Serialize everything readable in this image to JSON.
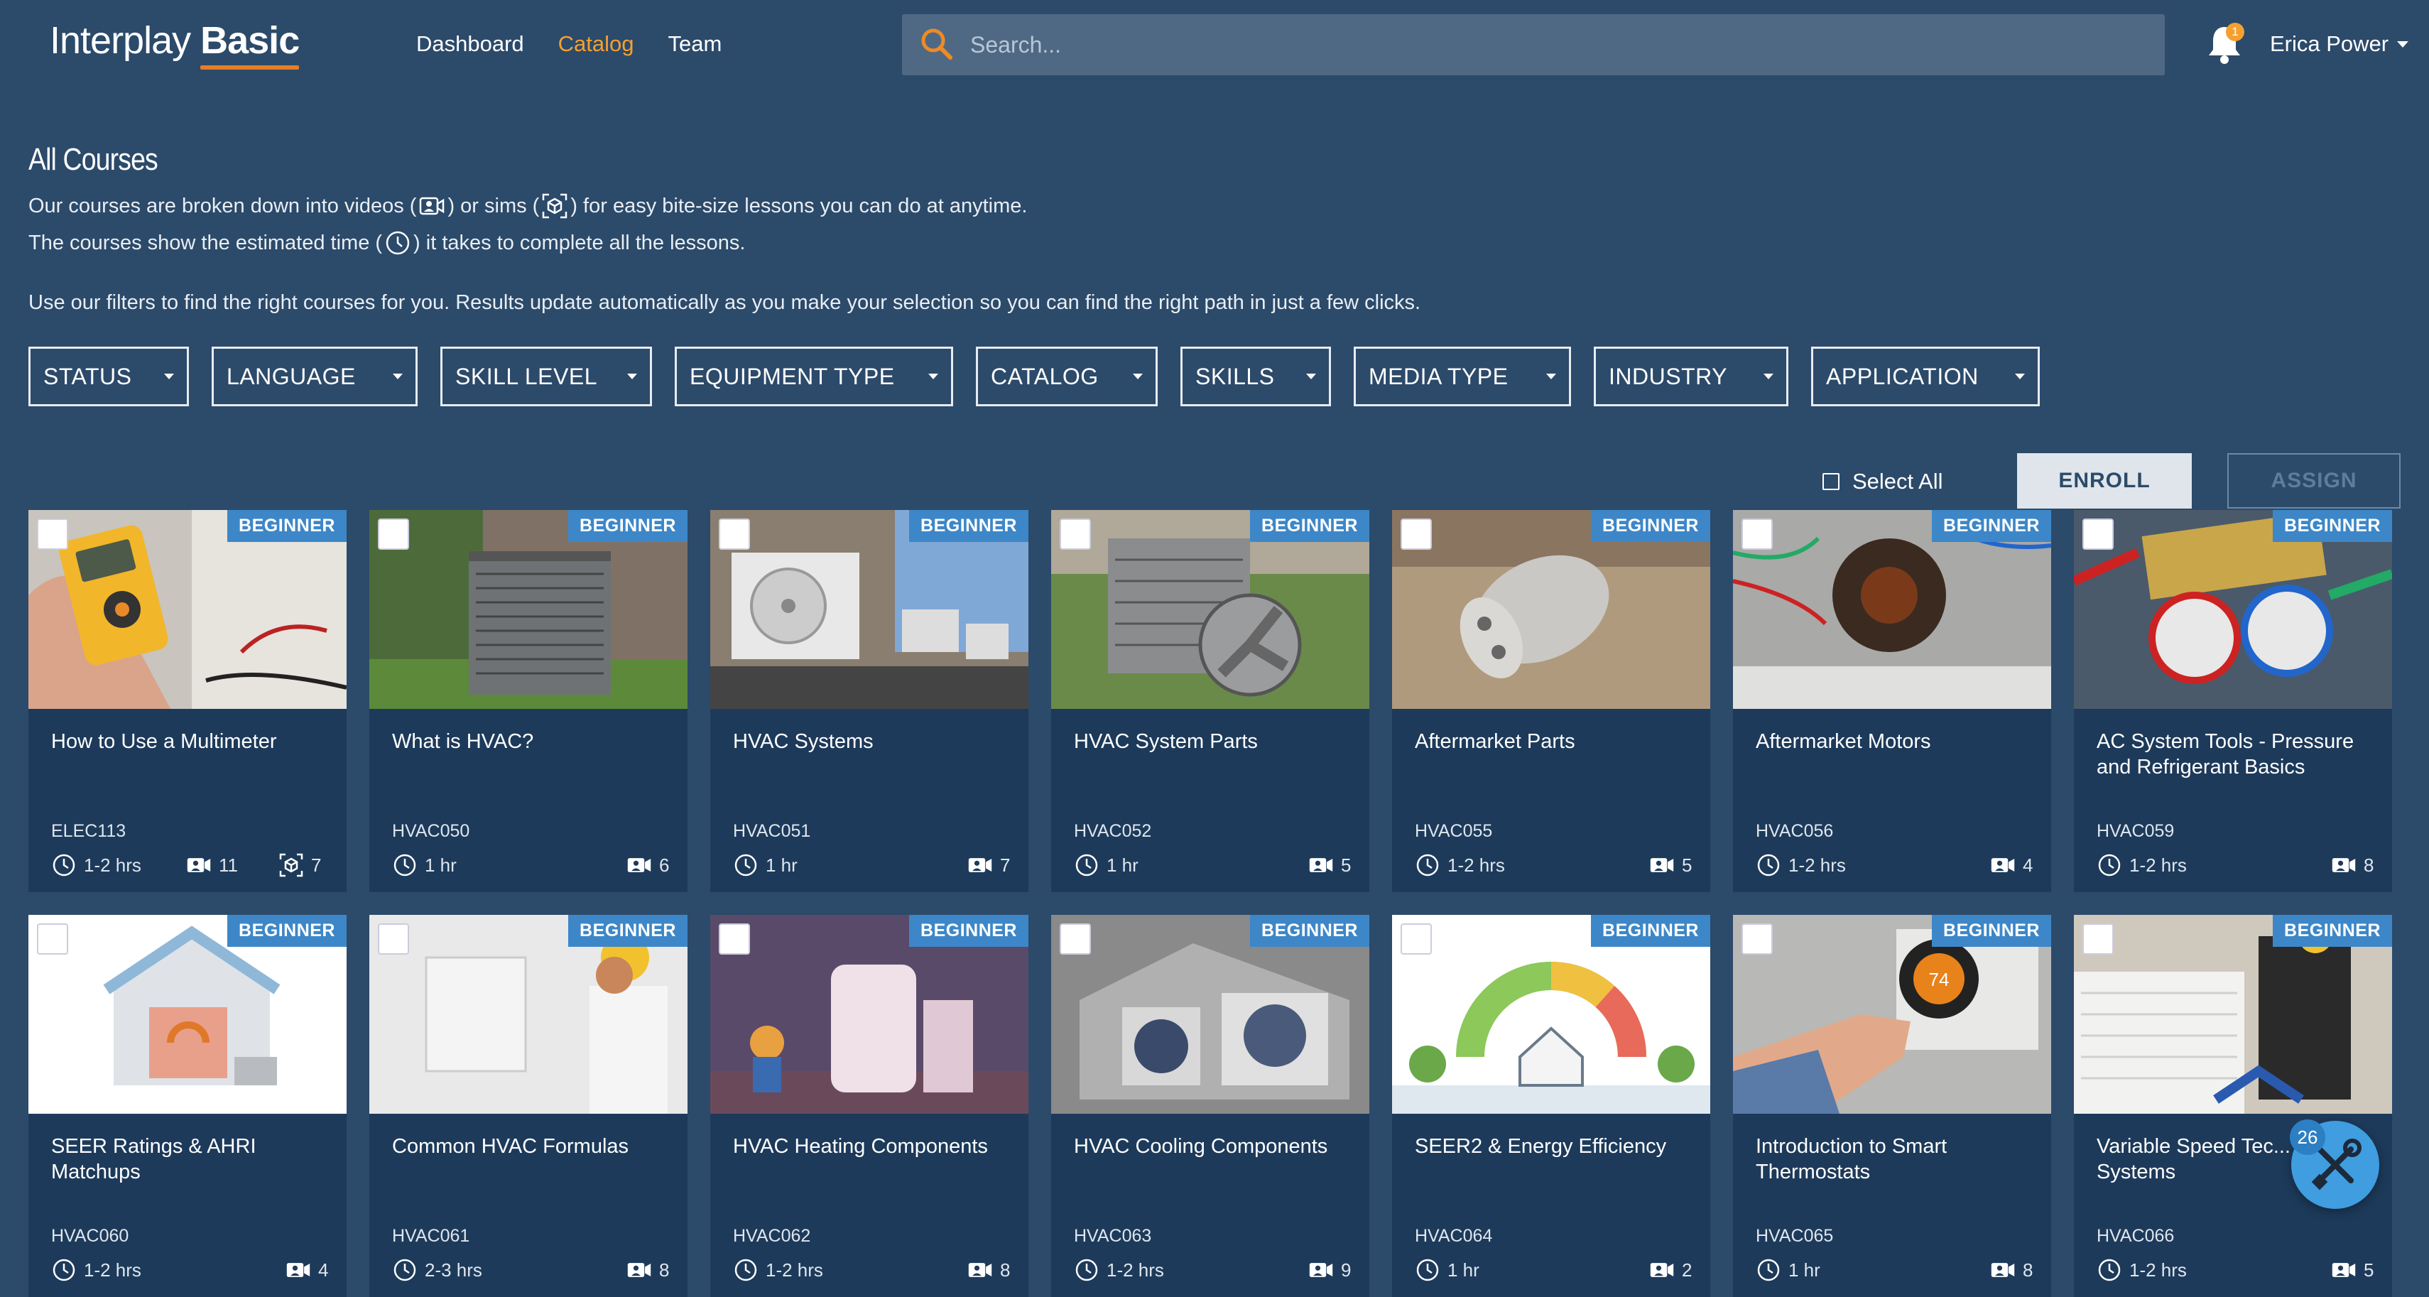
{
  "app": {
    "logo_part1": "Interplay",
    "logo_part2": "Basic"
  },
  "nav": [
    {
      "label": "Dashboard"
    },
    {
      "label": "Catalog",
      "active": true
    },
    {
      "label": "Team"
    }
  ],
  "search": {
    "placeholder": "Search..."
  },
  "notifications": {
    "count": "1"
  },
  "user": {
    "name": "Erica Power"
  },
  "page": {
    "title": "All Courses",
    "line1_a": "Our courses are broken down into videos (",
    "line1_b": ") or sims (",
    "line1_c": ") for easy bite-size lessons you can do at anytime.",
    "line2_a": "The courses show the estimated time (",
    "line2_b": ") it takes to complete all the lessons.",
    "line3": "Use our filters to find the right courses for you. Results update automatically as you make your selection so you can find the right path in just a few clicks."
  },
  "filters": [
    "STATUS",
    "LANGUAGE",
    "SKILL LEVEL",
    "EQUIPMENT TYPE",
    "CATALOG",
    "SKILLS",
    "MEDIA TYPE",
    "INDUSTRY",
    "APPLICATION"
  ],
  "actions": {
    "select_all": "Select All",
    "enroll": "ENROLL",
    "assign": "ASSIGN"
  },
  "courses": [
    {
      "title": "How to Use a Multimeter",
      "code": "ELEC113",
      "time": "1-2 hrs",
      "videos": "11",
      "sims": "7",
      "level": "BEGINNER"
    },
    {
      "title": "What is HVAC?",
      "code": "HVAC050",
      "time": "1 hr",
      "videos": "6",
      "level": "BEGINNER"
    },
    {
      "title": "HVAC Systems",
      "code": "HVAC051",
      "time": "1 hr",
      "videos": "7",
      "level": "BEGINNER"
    },
    {
      "title": "HVAC System Parts",
      "code": "HVAC052",
      "time": "1 hr",
      "videos": "5",
      "level": "BEGINNER"
    },
    {
      "title": "Aftermarket Parts",
      "code": "HVAC055",
      "time": "1-2 hrs",
      "videos": "5",
      "level": "BEGINNER"
    },
    {
      "title": "Aftermarket Motors",
      "code": "HVAC056",
      "time": "1-2 hrs",
      "videos": "4",
      "level": "BEGINNER"
    },
    {
      "title": "AC System Tools - Pressure and Refrigerant Basics",
      "code": "HVAC059",
      "time": "1-2 hrs",
      "videos": "8",
      "level": "BEGINNER"
    },
    {
      "title": "SEER Ratings & AHRI Matchups",
      "code": "HVAC060",
      "time": "1-2 hrs",
      "videos": "4",
      "level": "BEGINNER"
    },
    {
      "title": "Common HVAC Formulas",
      "code": "HVAC061",
      "time": "2-3 hrs",
      "videos": "8",
      "level": "BEGINNER"
    },
    {
      "title": "HVAC Heating Components",
      "code": "HVAC062",
      "time": "1-2 hrs",
      "videos": "8",
      "level": "BEGINNER"
    },
    {
      "title": "HVAC Cooling Components",
      "code": "HVAC063",
      "time": "1-2 hrs",
      "videos": "9",
      "level": "BEGINNER"
    },
    {
      "title": "SEER2 & Energy Efficiency",
      "code": "HVAC064",
      "time": "1 hr",
      "videos": "2",
      "level": "BEGINNER"
    },
    {
      "title": "Introduction to Smart Thermostats",
      "code": "HVAC065",
      "time": "1 hr",
      "videos": "8",
      "level": "BEGINNER"
    },
    {
      "title": "Variable Speed Tec... in HVAC Systems",
      "code": "HVAC066",
      "time": "1-2 hrs",
      "videos": "5",
      "level": "BEGINNER"
    }
  ],
  "thermostat_reading": "74",
  "fab": {
    "count": "26"
  },
  "colors": {
    "background": "#2c4a6a",
    "card": "#1d3a5a",
    "accent": "#f5a030",
    "badge": "#3d87c8"
  }
}
